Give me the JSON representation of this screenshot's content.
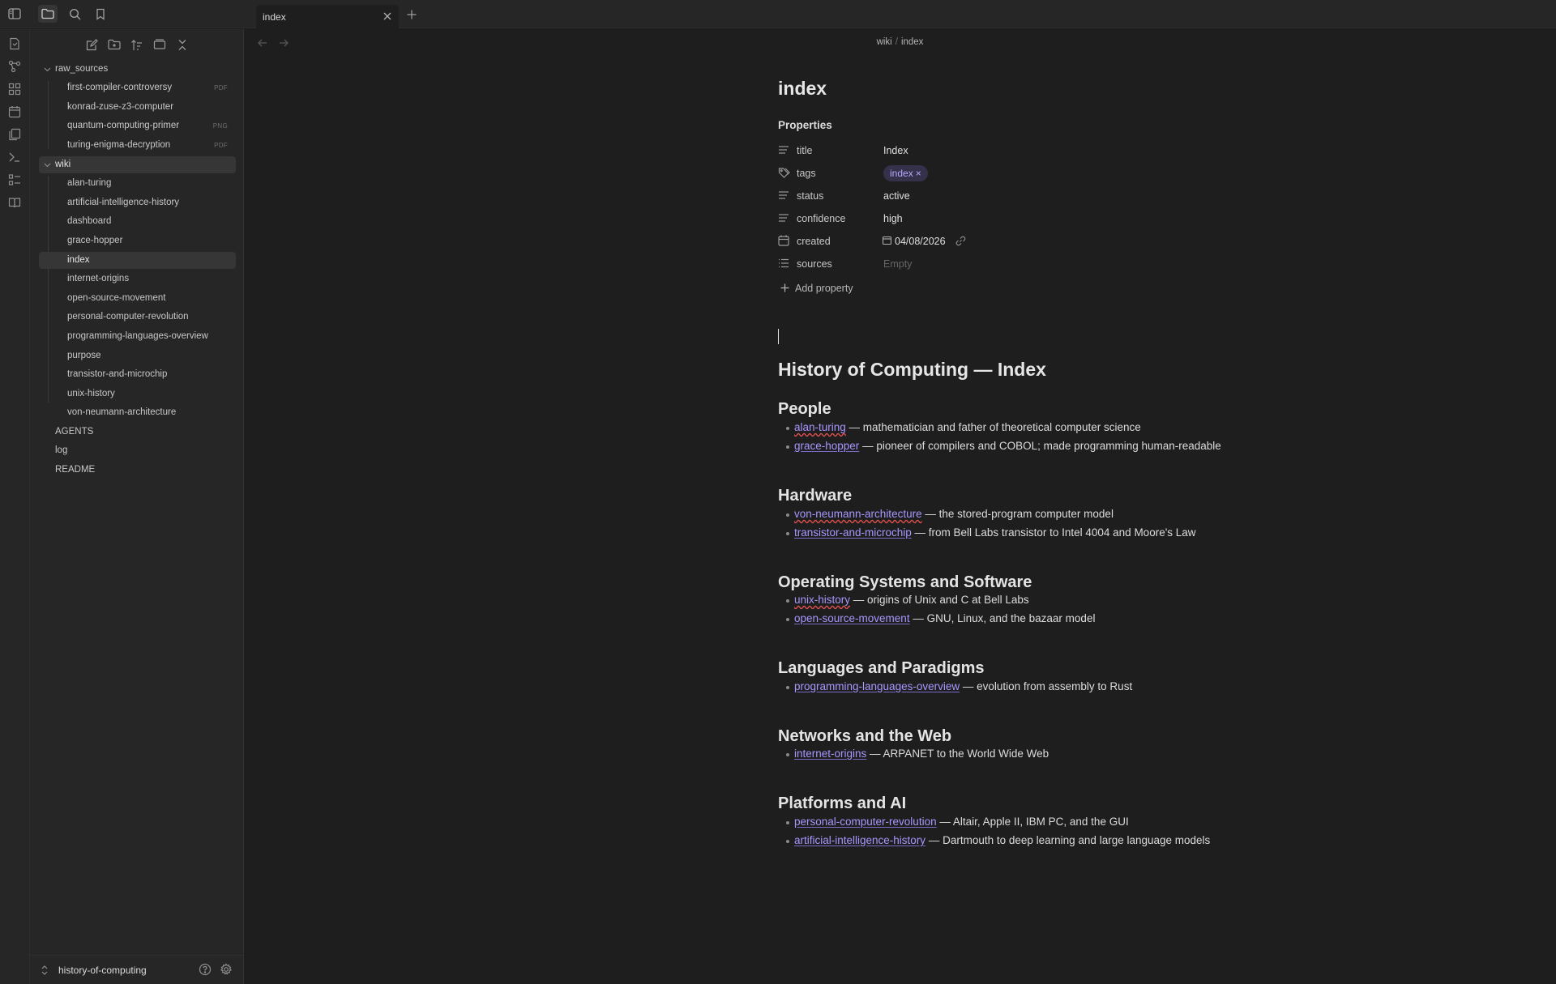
{
  "tab": {
    "title": "index"
  },
  "breadcrumb": {
    "folder": "wiki",
    "separator": "/",
    "file": "index"
  },
  "sidebar": {
    "tree": [
      {
        "label": "raw_sources",
        "kind": "folder"
      },
      {
        "label": "first-compiler-controversy",
        "ext": "PDF"
      },
      {
        "label": "konrad-zuse-z3-computer",
        "ext": ""
      },
      {
        "label": "quantum-computing-primer",
        "ext": "PNG"
      },
      {
        "label": "turing-enigma-decryption",
        "ext": "PDF"
      },
      {
        "label": "wiki",
        "kind": "folder"
      },
      {
        "label": "alan-turing"
      },
      {
        "label": "artificial-intelligence-history"
      },
      {
        "label": "dashboard"
      },
      {
        "label": "grace-hopper"
      },
      {
        "label": "index"
      },
      {
        "label": "internet-origins"
      },
      {
        "label": "open-source-movement"
      },
      {
        "label": "personal-computer-revolution"
      },
      {
        "label": "programming-languages-overview"
      },
      {
        "label": "purpose"
      },
      {
        "label": "transistor-and-microchip"
      },
      {
        "label": "unix-history"
      },
      {
        "label": "von-neumann-architecture"
      },
      {
        "label": "AGENTS"
      },
      {
        "label": "log"
      },
      {
        "label": "README"
      }
    ],
    "vault_name": "history-of-computing"
  },
  "note": {
    "title": "index",
    "properties_heading": "Properties",
    "properties": {
      "title": {
        "key": "title",
        "value": "Index"
      },
      "tags": {
        "key": "tags",
        "value": "index",
        "remove": "×"
      },
      "status": {
        "key": "status",
        "value": "active"
      },
      "confidence": {
        "key": "confidence",
        "value": "high"
      },
      "created": {
        "key": "created",
        "value": "04/08/2026"
      },
      "sources": {
        "key": "sources",
        "value": "Empty"
      }
    },
    "add_property": "Add property",
    "heading": "History of Computing — Index",
    "sections": [
      {
        "title": "People",
        "items": [
          {
            "link": "alan-turing",
            "text": " — mathematician and father of theoretical computer science"
          },
          {
            "link": "grace-hopper",
            "text": " — pioneer of compilers and COBOL; made programming human-readable"
          }
        ]
      },
      {
        "title": "Hardware",
        "items": [
          {
            "link": "von-neumann-architecture",
            "text": " — the stored-program computer model"
          },
          {
            "link": "transistor-and-microchip",
            "text": " — from Bell Labs transistor to Intel 4004 and Moore's Law"
          }
        ]
      },
      {
        "title": "Operating Systems and Software",
        "items": [
          {
            "link": "unix-history",
            "text": " — origins of Unix and C at Bell Labs"
          },
          {
            "link": "open-source-movement",
            "text": " — GNU, Linux, and the bazaar model"
          }
        ]
      },
      {
        "title": "Languages and Paradigms",
        "items": [
          {
            "link": "programming-languages-overview",
            "text": " — evolution from assembly to Rust"
          }
        ]
      },
      {
        "title": "Networks and the Web",
        "items": [
          {
            "link": "internet-origins",
            "text": " — ARPANET to the World Wide Web"
          }
        ]
      },
      {
        "title": "Platforms and AI",
        "items": [
          {
            "link": "personal-computer-revolution",
            "text": " — Altair, Apple II, IBM PC, and the GUI"
          },
          {
            "link": "artificial-intelligence-history",
            "text": " — Dartmouth to deep learning and large language models"
          }
        ]
      }
    ]
  },
  "colors": {
    "accent": "#a996ff",
    "background": "#1e1e1e",
    "sidebar": "#262626",
    "tag_bg": "#35314a"
  }
}
